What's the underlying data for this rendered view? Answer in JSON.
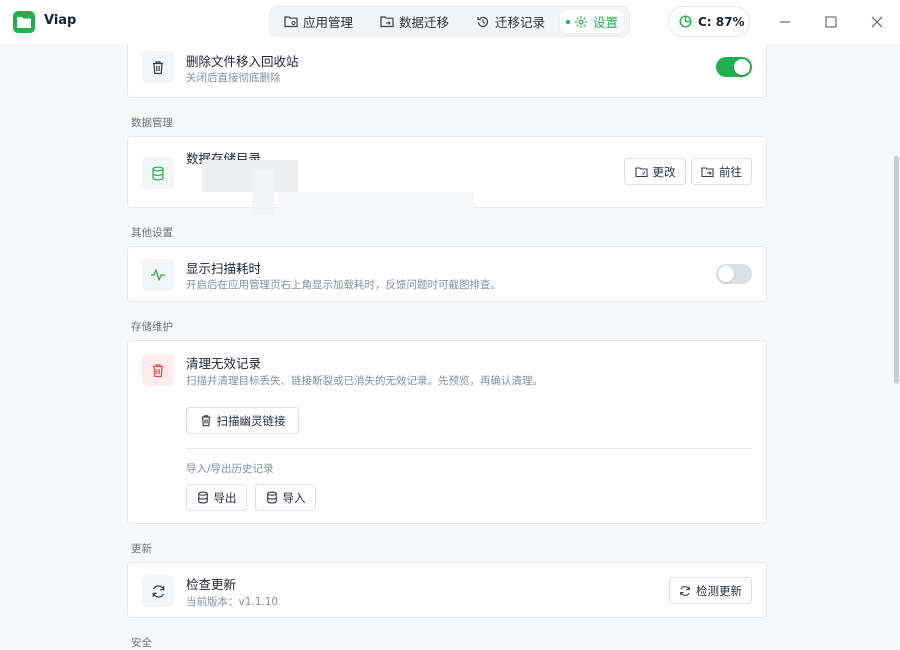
{
  "app": {
    "name": "Viap"
  },
  "nav": {
    "tabs": [
      {
        "label": "应用管理",
        "icon": "folder-gear-icon"
      },
      {
        "label": "数据迁移",
        "icon": "folder-transfer-icon"
      },
      {
        "label": "迁移记录",
        "icon": "history-icon"
      },
      {
        "label": "设置",
        "icon": "gear-icon",
        "active": true
      }
    ]
  },
  "storage": {
    "label": "C: 87%",
    "percent": 87
  },
  "settings": {
    "recycle": {
      "title": "删除文件移入回收站",
      "desc": "关闭后直接彻底删除",
      "enabled": true
    },
    "data_section": {
      "label": "数据管理",
      "storage_dir": {
        "title": "数据存储目录",
        "change_button": "更改",
        "goto_button": "前往"
      }
    },
    "other_section": {
      "label": "其他设置",
      "scan_time": {
        "title": "显示扫描耗时",
        "desc": "开启后在应用管理页右上角显示加载耗时，反馈问题时可截图排查。",
        "enabled": false
      }
    },
    "maintenance_section": {
      "label": "存储维护",
      "cleanup": {
        "title": "清理无效记录",
        "desc": "扫描并清理目标丢失、链接断裂或已消失的无效记录。先预览，再确认清理。",
        "scan_button": "扫描幽灵链接",
        "history_label": "导入/导出历史记录",
        "export_button": "导出",
        "import_button": "导入"
      }
    },
    "update_section": {
      "label": "更新",
      "check": {
        "title": "检查更新",
        "desc": "当前版本：v1.1.10",
        "button": "检测更新"
      }
    },
    "security_section": {
      "label": "安全"
    }
  },
  "colors": {
    "accent": "#22b04e",
    "danger": "#e5484d"
  }
}
